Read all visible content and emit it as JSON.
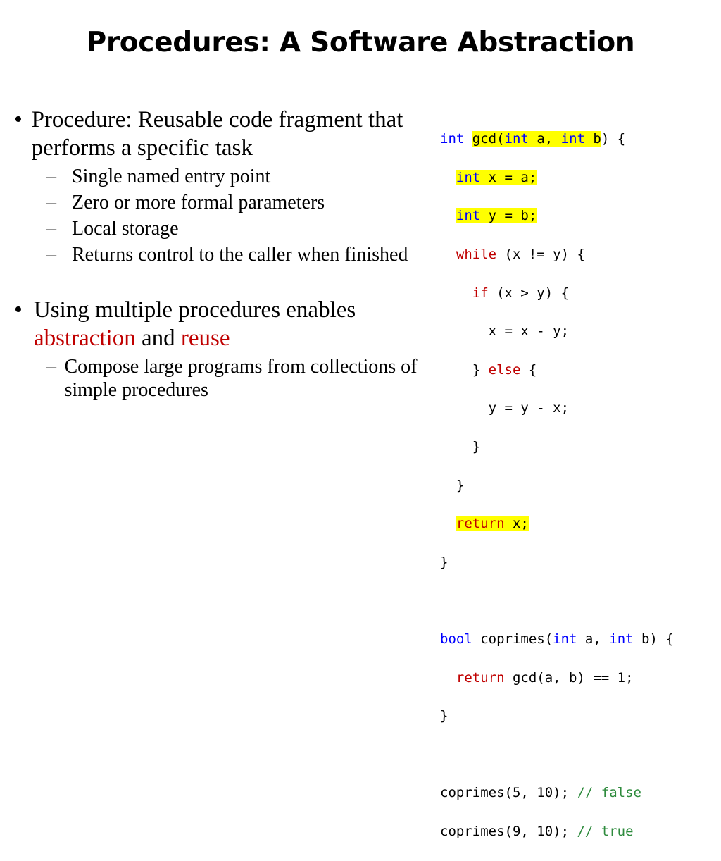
{
  "title": "Procedures: A Software Abstraction",
  "bullets": [
    {
      "text": "Procedure: Reusable code fragment that performs a specific task",
      "subs": [
        "Single named entry point",
        "Zero or more formal parameters",
        "Local storage",
        "Returns control to the caller when finished"
      ]
    },
    {
      "text_parts": [
        "Using multiple procedures enables ",
        "abstraction",
        " and ",
        "reuse"
      ],
      "subs": [
        "Compose large programs from collections of simple procedures"
      ]
    }
  ],
  "markers": {
    "bullet": "•",
    "dash": "–"
  },
  "code": {
    "gcd_sig": {
      "kw1": "int",
      "name": "gcd(",
      "kw2": "int",
      "p1": " a, ",
      "kw3": "int",
      "p2": " b",
      "close": ") {"
    },
    "line_x": {
      "kw": "int",
      "rest": " x = a;"
    },
    "line_y": {
      "kw": "int",
      "rest": " y = b;"
    },
    "line_while": {
      "kw": "while",
      "rest": " (x != y) {"
    },
    "line_if": {
      "kw": "if",
      "rest": " (x > y) {"
    },
    "line_xsub": "x = x - y;",
    "line_else": {
      "pre": "} ",
      "kw": "else",
      "post": " {"
    },
    "line_ysub": "y = y - x;",
    "line_close_inner": "}",
    "line_close_while": "}",
    "line_return": {
      "kw": "return",
      "rest": " x;"
    },
    "line_close_fn": "}",
    "coprimes_sig": {
      "kw1": "bool",
      "name": " coprimes(",
      "kw2": "int",
      "p1": " a, ",
      "kw3": "int",
      "p2": " b) {"
    },
    "coprimes_ret": {
      "kw": "return",
      "rest": " gcd(a, b) == 1;"
    },
    "coprimes_close": "}",
    "call1": {
      "code": "coprimes(5, 10); ",
      "comment": "// false"
    },
    "call2": {
      "code": "coprimes(9, 10); ",
      "comment": "// true"
    }
  },
  "colors": {
    "keyword": "#0000ff",
    "control": "#c00000",
    "comment": "#2e8b3d",
    "highlight": "#ffff00",
    "emphasis": "#c00000"
  }
}
